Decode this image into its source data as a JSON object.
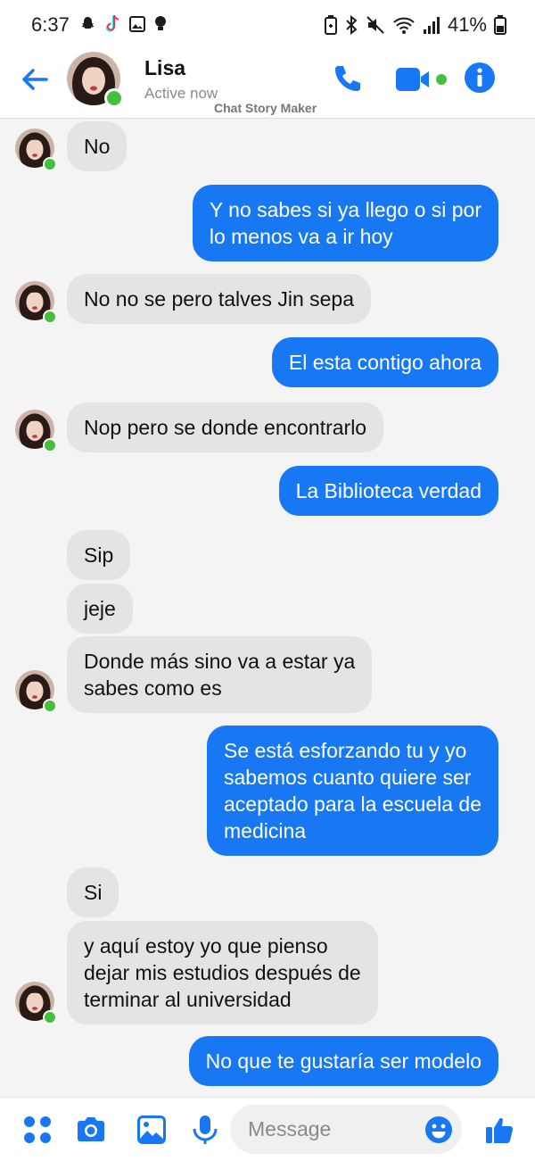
{
  "status_bar": {
    "time": "6:37",
    "battery": "41%",
    "left_icons": [
      "snapchat-icon",
      "tiktok-icon",
      "gallery-icon",
      "bulb-icon"
    ],
    "right_icons": [
      "battery-saver-icon",
      "bluetooth-icon",
      "mute-icon",
      "wifi-icon",
      "signal-icon",
      "battery-icon"
    ]
  },
  "header": {
    "name": "Lisa",
    "status": "Active now",
    "watermark": "Chat Story Maker",
    "accent": "#1878f3",
    "presence_color": "#44c03e"
  },
  "messages": [
    {
      "side": "in",
      "lines": [
        "No"
      ]
    },
    {
      "side": "out",
      "lines": [
        "Y no sabes si ya llego o si por",
        "lo menos va a ir hoy"
      ]
    },
    {
      "side": "in",
      "lines": [
        "No no se pero talves Jin sepa"
      ]
    },
    {
      "side": "out",
      "lines": [
        "El esta contigo ahora"
      ]
    },
    {
      "side": "in",
      "lines": [
        "Nop pero se donde encontrarlo"
      ]
    },
    {
      "side": "out",
      "lines": [
        "La Biblioteca verdad"
      ]
    },
    {
      "side": "in",
      "lines": [
        "Sip"
      ]
    },
    {
      "side": "in",
      "lines": [
        "jeje"
      ]
    },
    {
      "side": "in",
      "lines": [
        "Donde más sino va a estar ya",
        "sabes como es"
      ]
    },
    {
      "side": "out",
      "lines": [
        "Se está esforzando tu y yo",
        "sabemos cuanto quiere ser",
        "aceptado para la escuela de",
        "medicina"
      ]
    },
    {
      "side": "in",
      "lines": [
        "Si"
      ]
    },
    {
      "side": "in",
      "lines": [
        "y aquí estoy yo que pienso",
        "dejar mis estudios después de",
        "terminar al universidad"
      ]
    },
    {
      "side": "out",
      "lines": [
        "No que te gustaría ser modelo"
      ]
    }
  ],
  "composer": {
    "placeholder": "Message",
    "icons": [
      "menu-dots-icon",
      "camera-icon",
      "gallery-icon",
      "microphone-icon",
      "emoji-icon",
      "thumbs-up-icon"
    ]
  }
}
